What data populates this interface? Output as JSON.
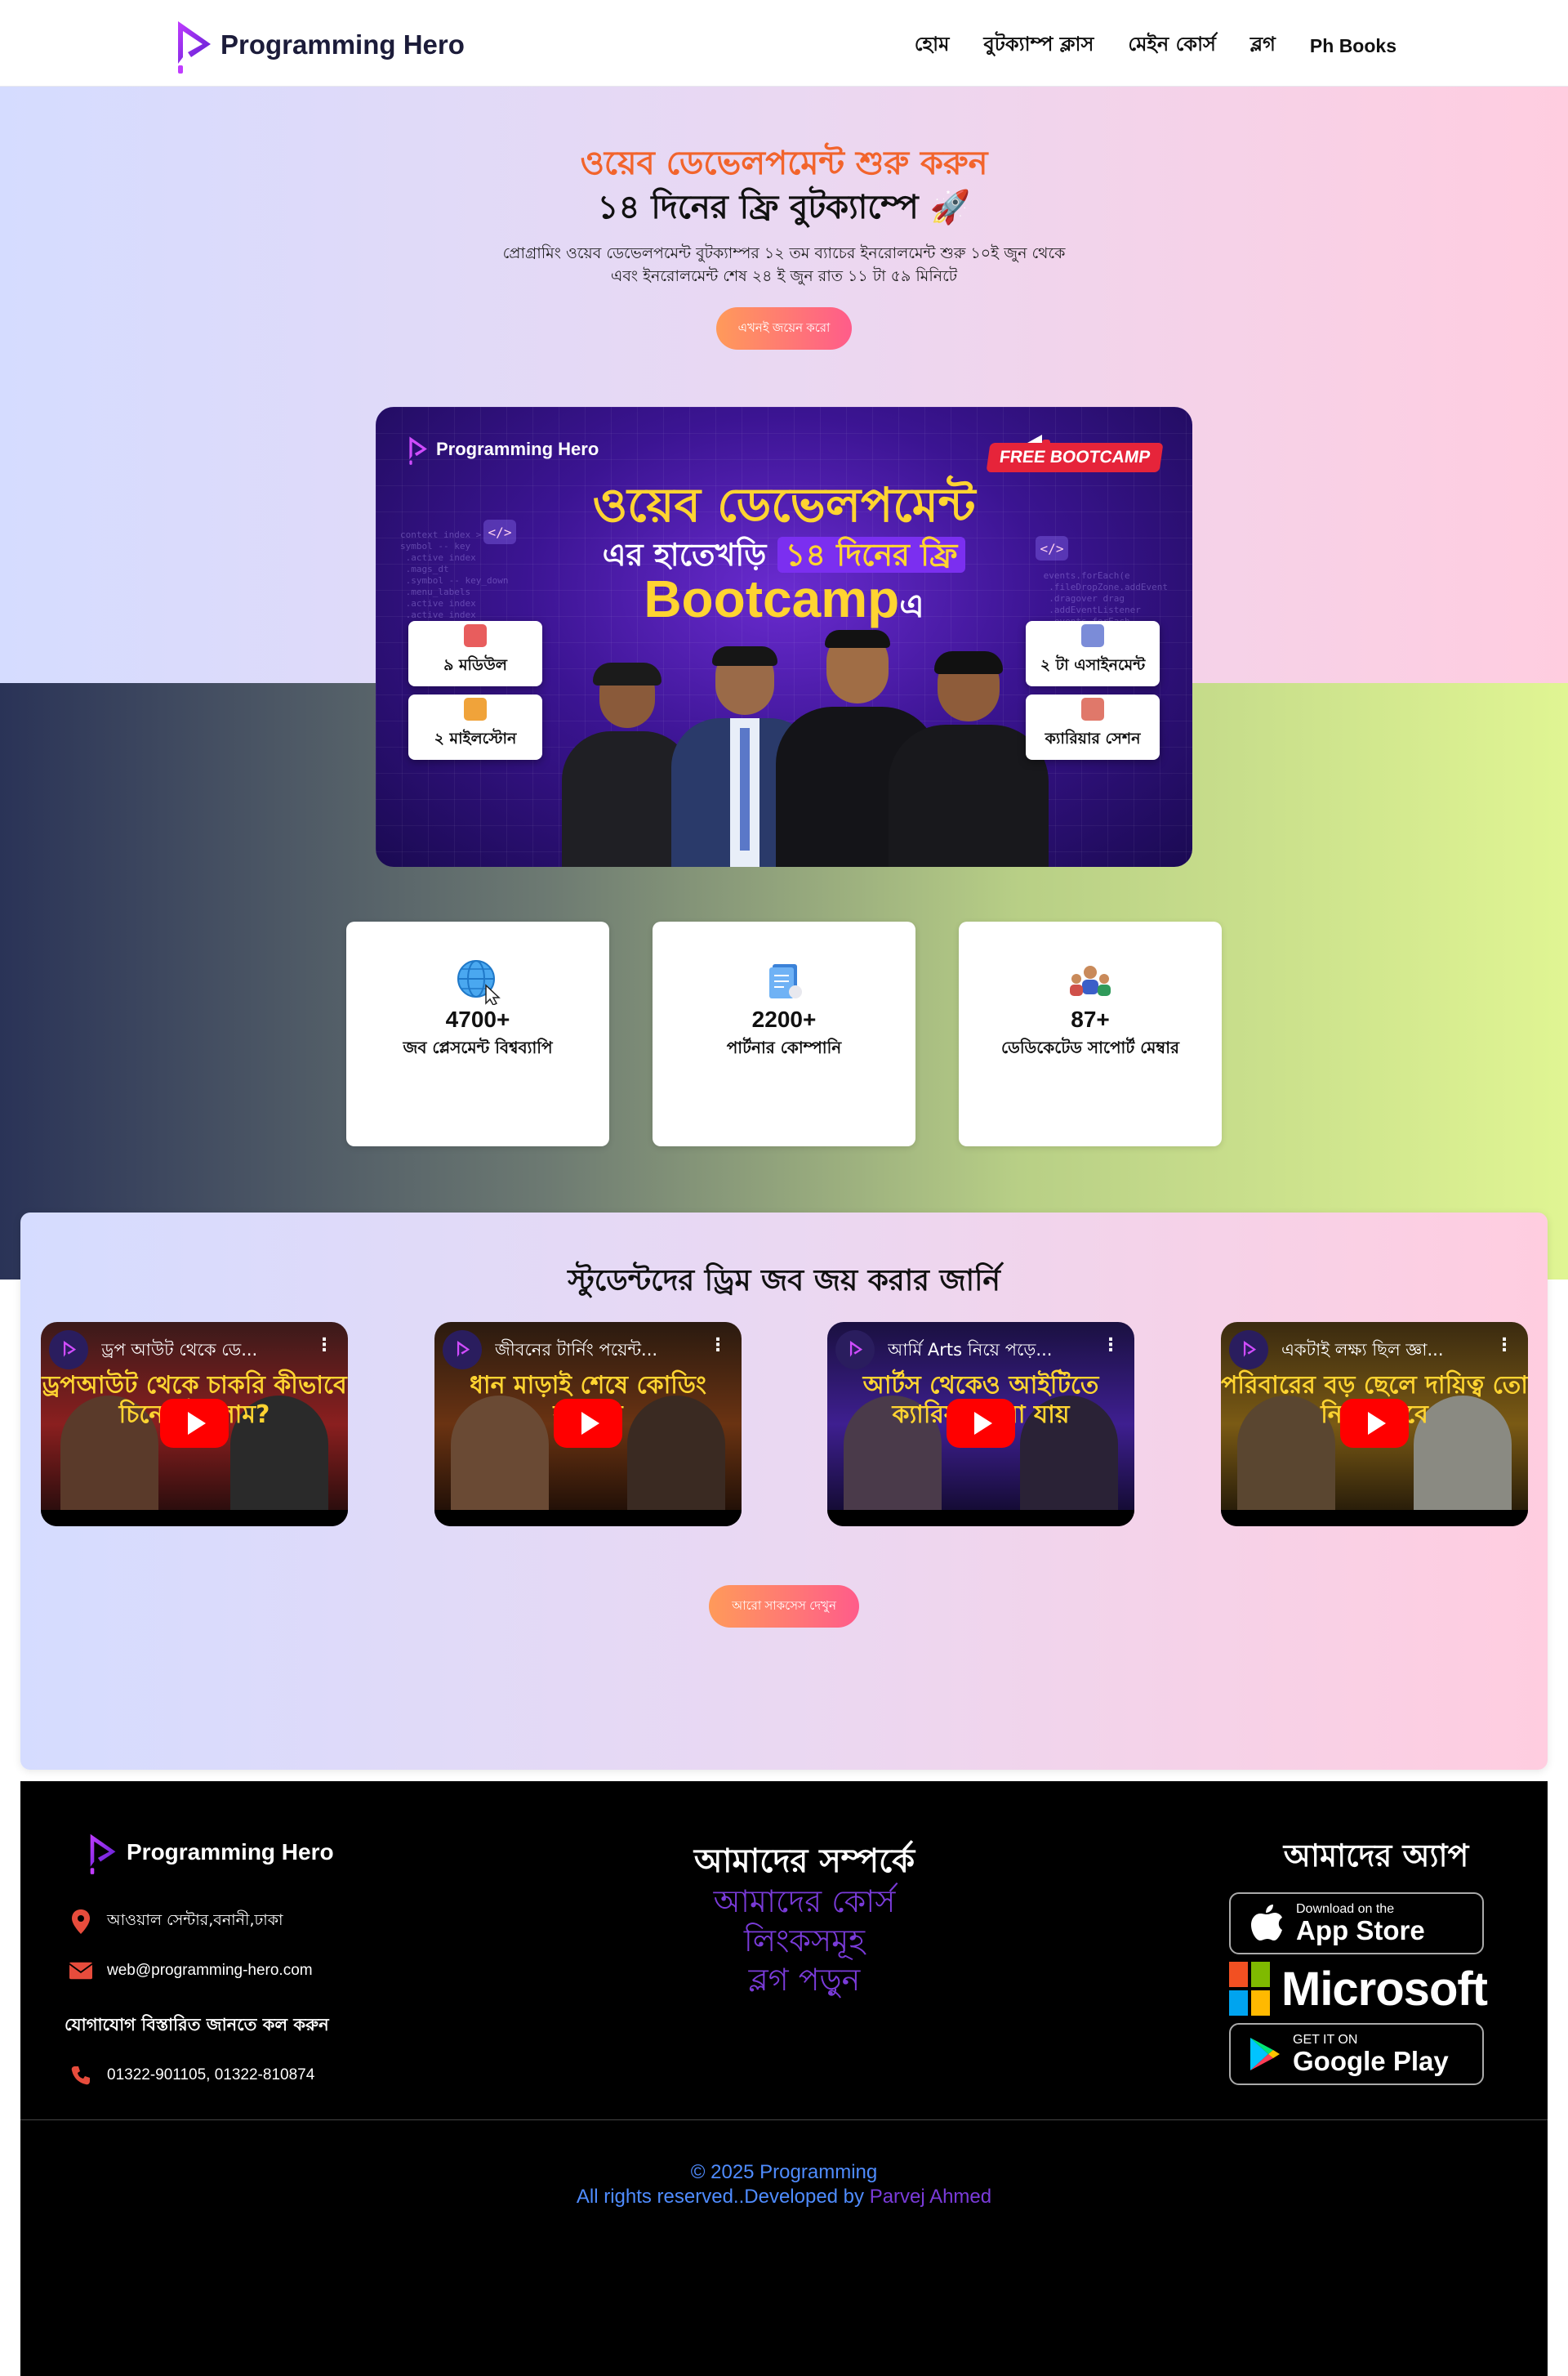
{
  "header": {
    "brand": "Programming Hero",
    "nav": [
      "হোম",
      "বুটক্যাম্প ক্লাস",
      "মেইন কোর্স",
      "ব্লগ",
      "Ph Books"
    ]
  },
  "hero": {
    "title_1": "ওয়েব ডেভেলপমেন্ট শুরু করুন",
    "title_2": "১৪ দিনের ফ্রি বুটক্যাম্পে 🚀",
    "desc_1": "প্রোগ্রামিং ওয়েব ডেভেলপমেন্ট বুটক্যাম্পর ১২ তম ব্যাচের ইনরোলমেন্ট শুরু ১০ই জুন থেকে",
    "desc_2": "এবং ইনরোলমেন্ট শেষ ২৪ ই জুন রাত ১১ টা ৫৯ মিনিটে",
    "cta": "এখনই জয়েন করো"
  },
  "banner": {
    "brand": "Programming Hero",
    "free_tag": "FREE BOOTCAMP",
    "line_1": "ওয়েব ডেভেলপমেন্ট",
    "line_2_a": "এর হাতেখড়ি",
    "line_2_b": "১৪ দিনের ফ্রি",
    "line_3_a": "Bootcamp",
    "line_3_b": "এ",
    "cards": [
      "৯ মডিউল",
      "২ মাইলস্টোন",
      "২ টা এসাইনমেন্ট",
      "ক্যারিয়ার সেশন"
    ]
  },
  "stats": [
    {
      "icon": "globe-icon",
      "value": "4700+",
      "label": "জব প্লেসমেন্ট বিশ্বব্যাপি"
    },
    {
      "icon": "document-icon",
      "value": "2200+",
      "label": "পার্টনার কোম্পানি"
    },
    {
      "icon": "team-icon",
      "value": "87+",
      "label": "ডেডিকেটেড সাপোর্ট মেম্বার"
    }
  ],
  "students": {
    "title": "স্টুডেন্টদের ড্রিম জব জয় করার জার্নি",
    "videos": [
      {
        "title": "ড্রপ আউট থেকে ডে...",
        "caption": "ড্রপআউট থেকে চাকরি কীভাবে চিনে দাঁড়ালাম?"
      },
      {
        "title": "জীবনের টার্নিং পয়েন্ট...",
        "caption": "ধান মাড়াই শেষে কোডিং করতাম"
      },
      {
        "title": "আর্মি Arts নিয়ে পড়ে...",
        "caption": "আর্টস থেকেও আইটিতে ক্যারিয়ার করা যায়"
      },
      {
        "title": "একটাই লক্ষ্য ছিল জ্ঞা...",
        "caption": "পরিবারের বড় ছেলে দায়িত্ব তো নিতেই হবে"
      }
    ],
    "more_button": "আরো সাকসেস দেখুন"
  },
  "footer": {
    "brand": "Programming Hero",
    "address": "আওয়াল সেন্টার,বনানী,ঢাকা",
    "email": "web@programming-hero.com",
    "call_heading": "যোগাযোগ বিস্তারিত জানতে কল করুন",
    "phone": "01322-901105, 01322-810874",
    "about_title": "আমাদের সম্পর্কে",
    "links": [
      "আমাদের কোর্স",
      "লিংকসমূহ",
      "ব্লগ পড়ুন"
    ],
    "app_title": "আমাদের অ্যাপ",
    "app_store_small": "Download on the",
    "app_store_big": "App Store",
    "microsoft": "Microsoft",
    "google_small": "GET IT ON",
    "google_big": "Google Play",
    "copyright": "© 2025 Programming",
    "rights": "All rights reserved..Developed by",
    "developer": "Parvej Ahmed"
  },
  "colors": {
    "accent_orange": "#f2642c",
    "brand_purple": "#7a3bd9",
    "link_blue": "#4f8cff"
  }
}
